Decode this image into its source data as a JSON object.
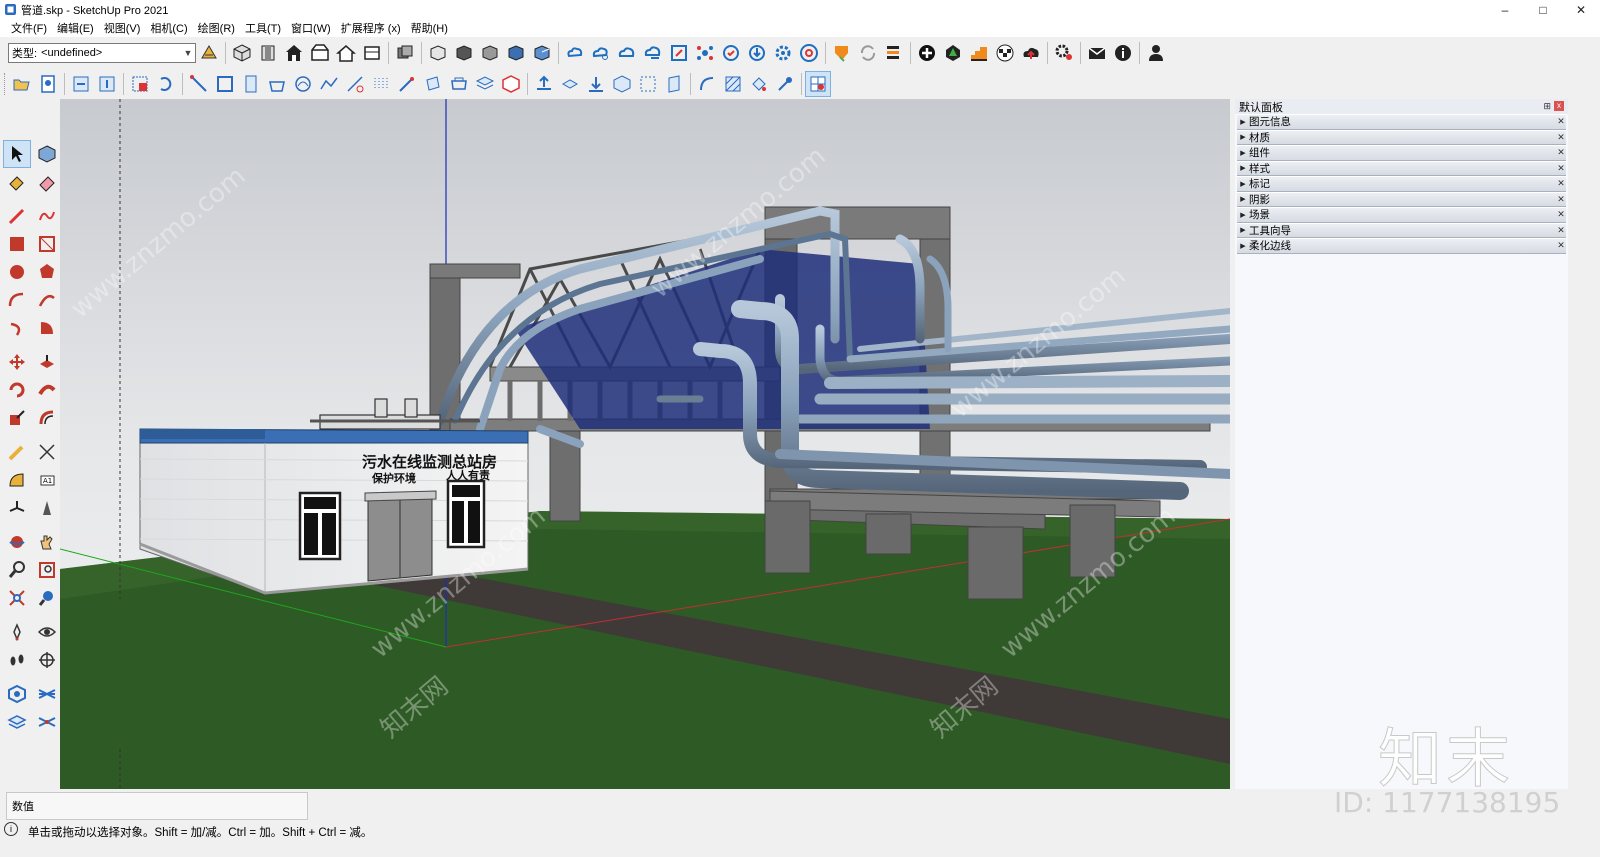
{
  "window": {
    "title": "管道.skp - SketchUp Pro 2021",
    "minimize": "–",
    "maximize": "□",
    "close": "✕"
  },
  "menu": [
    "文件(F)",
    "编辑(E)",
    "视图(V)",
    "相机(C)",
    "绘图(R)",
    "工具(T)",
    "窗口(W)",
    "扩展程序 (x)",
    "帮助(H)"
  ],
  "type_selector": {
    "label": "类型:",
    "value": "<undefined>"
  },
  "building": {
    "sign_title": "污水在线监测总站房",
    "slogan_left": "保护环境",
    "slogan_right": "人人有责"
  },
  "watermark": {
    "site": "www.znzmo.com",
    "cn": "知末网",
    "logo": "知末",
    "id": "ID: 1177138195"
  },
  "tray": {
    "title": "默认面板",
    "pin": "⊞",
    "close": "x",
    "items": [
      "图元信息",
      "材质",
      "组件",
      "样式",
      "标记",
      "阴影",
      "场景",
      "工具向导",
      "柔化边线"
    ]
  },
  "status": {
    "measure_label": "数值",
    "message": "单击或拖动以选择对象。Shift = 加/减。Ctrl = 加。Shift + Ctrl = 减。"
  },
  "colors": {
    "sky_top": "#c9ccd1",
    "sky_bottom": "#f2f2f2",
    "grass": "#2e5a25",
    "path": "#3f3a38",
    "pipe": "#8aa2bb",
    "structure": "#6e6e6e",
    "building": "#f2f2f2",
    "roof_trim": "#3a6fb5"
  }
}
